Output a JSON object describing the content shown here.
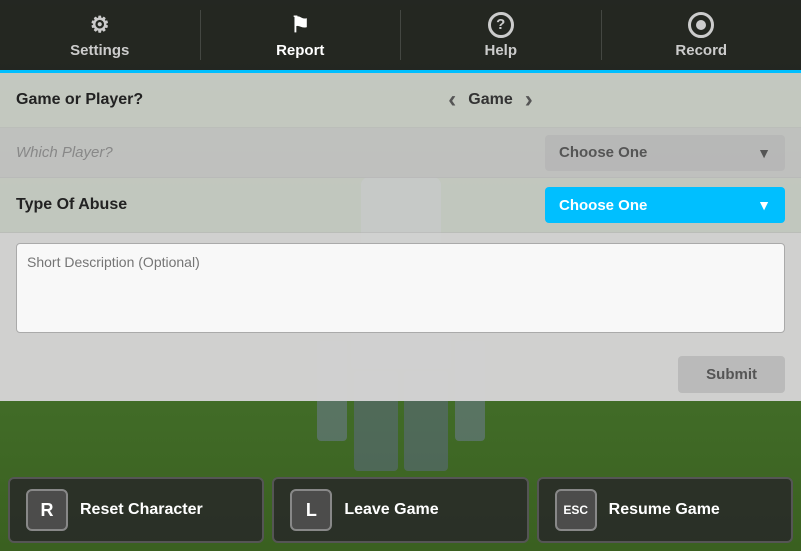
{
  "nav": {
    "items": [
      {
        "id": "settings",
        "label": "Settings",
        "icon": "⚙",
        "active": false
      },
      {
        "id": "report",
        "label": "Report",
        "icon": "🚩",
        "active": true
      },
      {
        "id": "help",
        "label": "Help",
        "icon": "?",
        "active": false
      },
      {
        "id": "record",
        "label": "Record",
        "icon": "record",
        "active": false
      }
    ]
  },
  "form": {
    "game_or_player_label": "Game or Player?",
    "game_or_player_value": "Game",
    "which_player_label": "Which Player?",
    "which_player_placeholder": "Choose One",
    "type_of_abuse_label": "Type Of Abuse",
    "type_of_abuse_placeholder": "Choose One",
    "description_placeholder": "Short Description (Optional)",
    "submit_label": "Submit"
  },
  "bottom": {
    "reset": {
      "key": "R",
      "label": "Reset Character"
    },
    "leave": {
      "key": "L",
      "label": "Leave Game"
    },
    "resume": {
      "key": "ESC",
      "label": "Resume Game"
    }
  }
}
